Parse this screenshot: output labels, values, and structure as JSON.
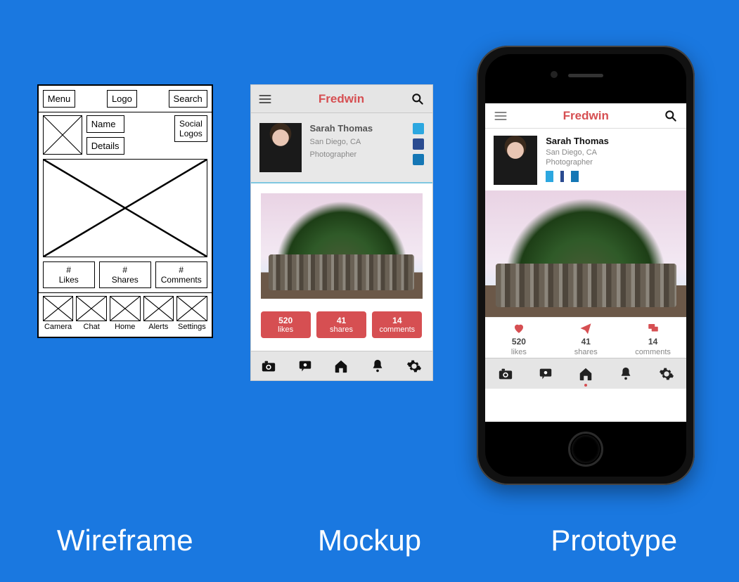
{
  "captions": {
    "wire": "Wireframe",
    "mock": "Mockup",
    "proto": "Prototype"
  },
  "wireframe": {
    "top": {
      "menu": "Menu",
      "logo": "Logo",
      "search": "Search"
    },
    "profile": {
      "name": "Name",
      "details": "Details",
      "social": "Social\nLogos"
    },
    "stats": {
      "likes": "#\nLikes",
      "shares": "#\nShares",
      "comments": "#\nComments"
    },
    "nav": {
      "camera": "Camera",
      "chat": "Chat",
      "home": "Home",
      "alerts": "Alerts",
      "settings": "Settings"
    }
  },
  "app": {
    "brand": "Fredwin",
    "user": {
      "name": "Sarah Thomas",
      "location": "San Diego, CA",
      "role": "Photographer"
    },
    "stats": {
      "likes": {
        "value": "520",
        "label": "likes"
      },
      "shares": {
        "value": "41",
        "label": "shares"
      },
      "comments": {
        "value": "14",
        "label": "comments"
      }
    }
  }
}
